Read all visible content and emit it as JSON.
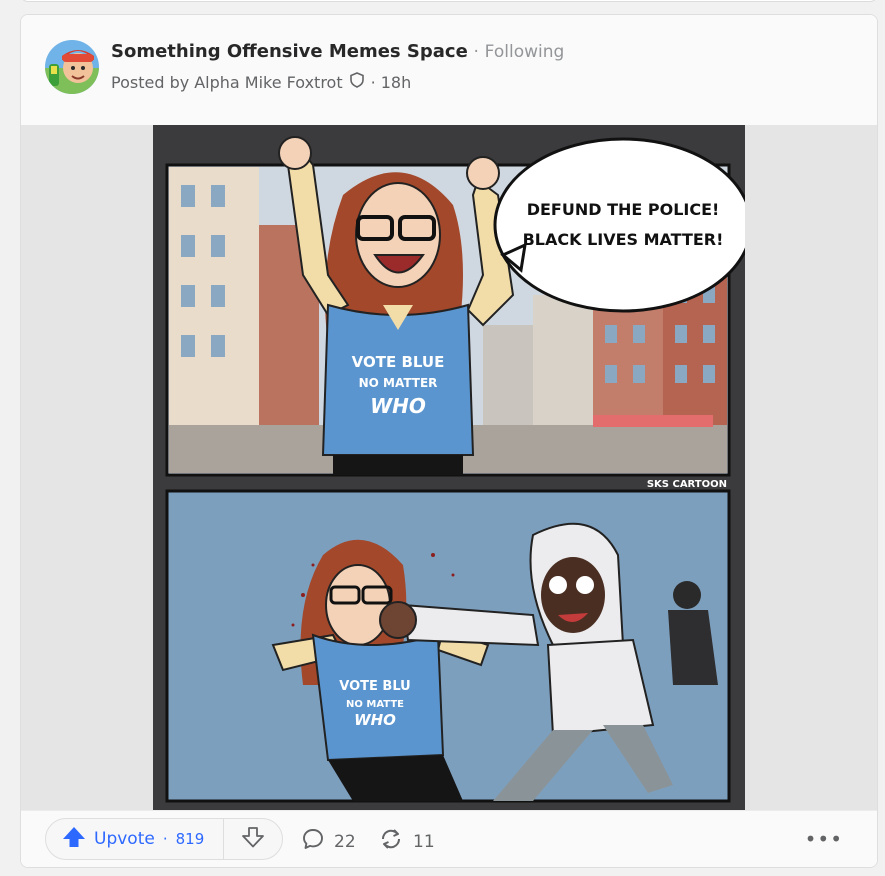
{
  "post": {
    "space_name": "Something Offensive Memes Space",
    "separator": "·",
    "follow_status": "Following",
    "posted_prefix": "Posted by",
    "author": "Alpha Mike Foxtrot",
    "time_separator": "·",
    "time_ago": "18h"
  },
  "image": {
    "bubble_line1": "DEFUND THE POLICE!",
    "bubble_line2": "BLACK LIVES MATTER!",
    "shirt_line1": "VOTE BLUE",
    "shirt_line2": "NO MATTER",
    "shirt_line3": "WHO",
    "shirt2_line1": "VOTE BLU",
    "shirt2_line2": "NO MATTE",
    "shirt2_line3": "WHO",
    "watermark": "SKS CARTOON"
  },
  "actions": {
    "upvote_label": "Upvote",
    "upvote_separator": "·",
    "upvote_count": "819",
    "comment_count": "22",
    "share_count": "11",
    "more_label": "•••"
  },
  "colors": {
    "accent": "#2e69ff",
    "text_primary": "#282829",
    "text_secondary": "#636466",
    "muted": "#939598"
  },
  "icons": {
    "avatar": "space-avatar",
    "moderator": "shield-icon",
    "upvote": "up-arrow-icon",
    "downvote": "down-arrow-icon",
    "comment": "speech-bubble-icon",
    "share": "share-cycle-icon",
    "more": "more-dots-icon"
  }
}
